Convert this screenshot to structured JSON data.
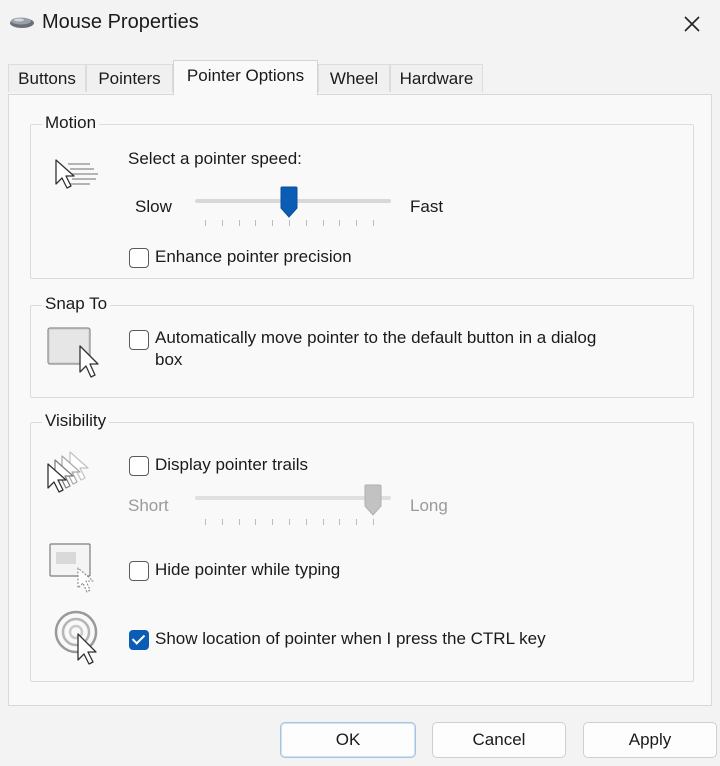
{
  "window": {
    "title": "Mouse Properties"
  },
  "tabs": [
    {
      "label": "Buttons",
      "active": false
    },
    {
      "label": "Pointers",
      "active": false
    },
    {
      "label": "Pointer Options",
      "active": true
    },
    {
      "label": "Wheel",
      "active": false
    },
    {
      "label": "Hardware",
      "active": false
    }
  ],
  "motion": {
    "legend": "Motion",
    "speed_label": "Select a pointer speed:",
    "slow_label": "Slow",
    "fast_label": "Fast",
    "speed_value": 0.5,
    "enhance_label": "Enhance pointer precision",
    "enhance_checked": false
  },
  "snap": {
    "legend": "Snap To",
    "auto_label_line1": "Automatically move pointer to the default button in a dialog",
    "auto_label_line2": "box",
    "auto_checked": false
  },
  "visibility": {
    "legend": "Visibility",
    "trails_label": "Display pointer trails",
    "trails_checked": false,
    "short_label": "Short",
    "long_label": "Long",
    "trail_length": 1.0,
    "hide_label": "Hide pointer while typing",
    "hide_checked": false,
    "ctrl_label": "Show location of pointer when I press the CTRL key",
    "ctrl_checked": true
  },
  "buttons": {
    "ok": "OK",
    "cancel": "Cancel",
    "apply": "Apply"
  },
  "colors": {
    "accent": "#0b5cb5",
    "disabled": "#9a9a9a"
  }
}
